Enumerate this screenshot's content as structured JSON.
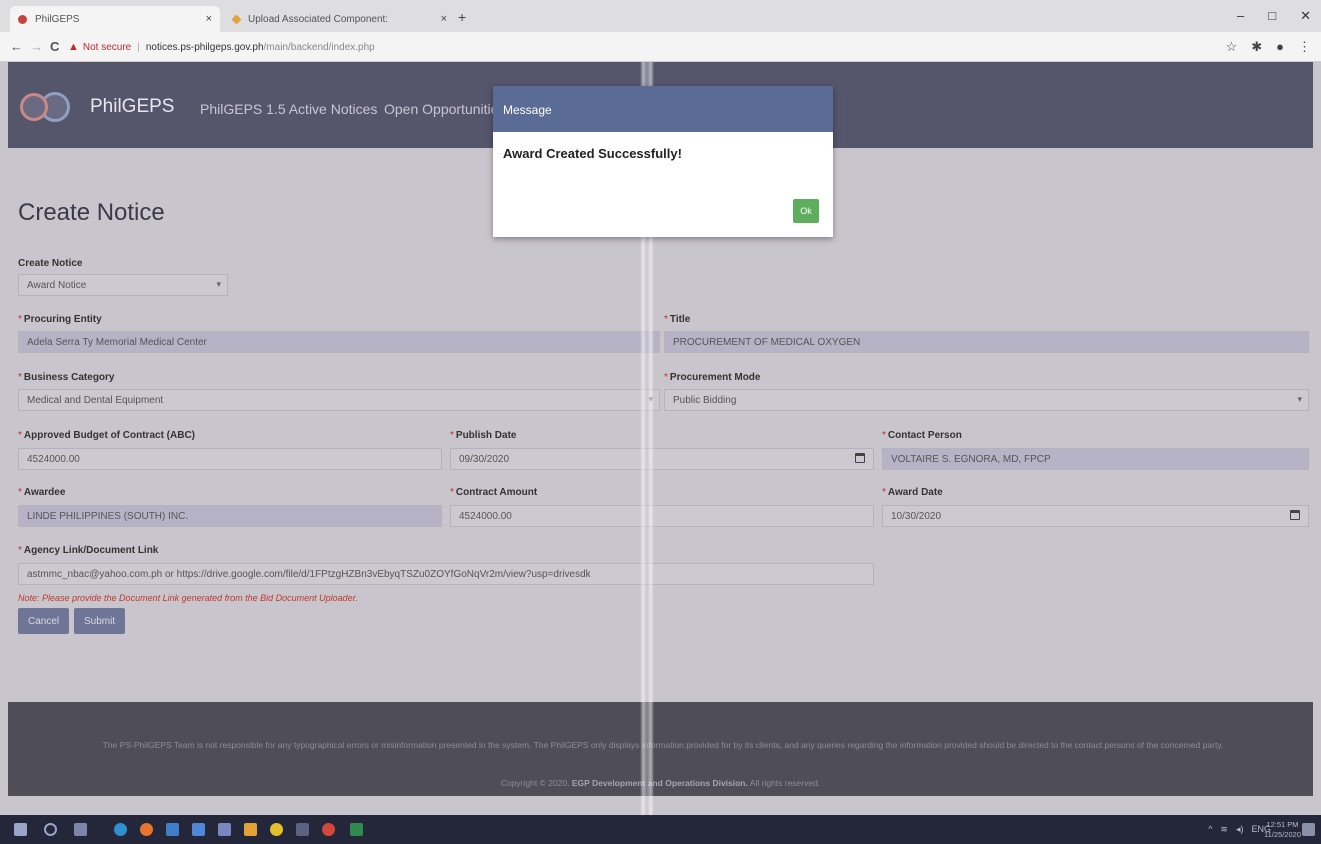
{
  "browser": {
    "tabs": [
      {
        "title": "PhilGEPS",
        "close": "×"
      },
      {
        "title": "Upload Associated Component:",
        "close": "×"
      }
    ],
    "new_tab": "+",
    "window_controls": {
      "minimize": "–",
      "maximize": "□",
      "close": "✕"
    },
    "nav": {
      "back": "←",
      "forward": "→",
      "reload": "C"
    },
    "security_label": "Not secure",
    "separator": "|",
    "url_host": "notices.ps-philgeps.gov.ph",
    "url_path": "/main/backend/index.php",
    "icons": [
      "star-icon",
      "extension-icon",
      "profile-icon",
      "menu-icon"
    ]
  },
  "navbar": {
    "brand": "PhilGEPS",
    "links": [
      "PhilGEPS 1.5 Active Notices",
      "Open Opportunities"
    ]
  },
  "form": {
    "page_title": "Create Notice",
    "notice_type_label": "Create Notice",
    "notice_type_value": "Award Notice",
    "procuring_entity_label": "Procuring Entity",
    "procuring_entity_value": "Adela Serra Ty Memorial Medical Center",
    "title_label": "Title",
    "title_value": "PROCUREMENT OF MEDICAL OXYGEN",
    "business_category_label": "Business Category",
    "business_category_value": "Medical and Dental Equipment",
    "procurement_mode_label": "Procurement Mode",
    "procurement_mode_value": "Public Bidding",
    "abc_label": "Approved Budget of Contract (ABC)",
    "abc_value": "4524000.00",
    "publish_date_label": "Publish Date",
    "publish_date_value": "09/30/2020",
    "contact_person_label": "Contact Person",
    "contact_person_value": "VOLTAIRE S. EGNORA, MD, FPCP",
    "awardee_label": "Awardee",
    "awardee_value": "LINDE PHILIPPINES (SOUTH) INC.",
    "contract_amount_label": "Contract Amount",
    "contract_amount_value": "4524000.00",
    "award_date_label": "Award Date",
    "award_date_value": "10/30/2020",
    "doc_link_label": "Agency Link/Document Link",
    "doc_link_value": "astmmc_nbac@yahoo.com.ph or https://drive.google.com/file/d/1FPtzgHZBn3vEbyqTSZu0ZOYfGoNqVr2m/view?usp=drivesdk",
    "note": "Note: Please provide the Document Link generated from the Bid Document Uploader.",
    "cancel_label": "Cancel",
    "submit_label": "Submit"
  },
  "footer": {
    "disclaimer": "The PS-PhilGEPS Team is not responsible for any typographical errors or misinformation presented in the system. The PhilGEPS only displays information provided for by its clients, and any queries regarding the information provided should be directed to the contact persons of the concerned party.",
    "copyright_prefix": "Copyright © 2020.",
    "copyright_org": "EGP Development and Operations Division.",
    "copyright_suffix": "All rights reserved."
  },
  "modal": {
    "title": "Message",
    "message": "Award Created Successfully!",
    "ok_label": "Ok"
  },
  "taskbar": {
    "lang": "ENG",
    "time": "12:51 PM",
    "date": "11/25/2020"
  },
  "colors": {
    "navbar": "#55556c",
    "modal_header": "#5a6b95",
    "ok_button": "#5fae5f",
    "note_red": "#c0392b"
  }
}
